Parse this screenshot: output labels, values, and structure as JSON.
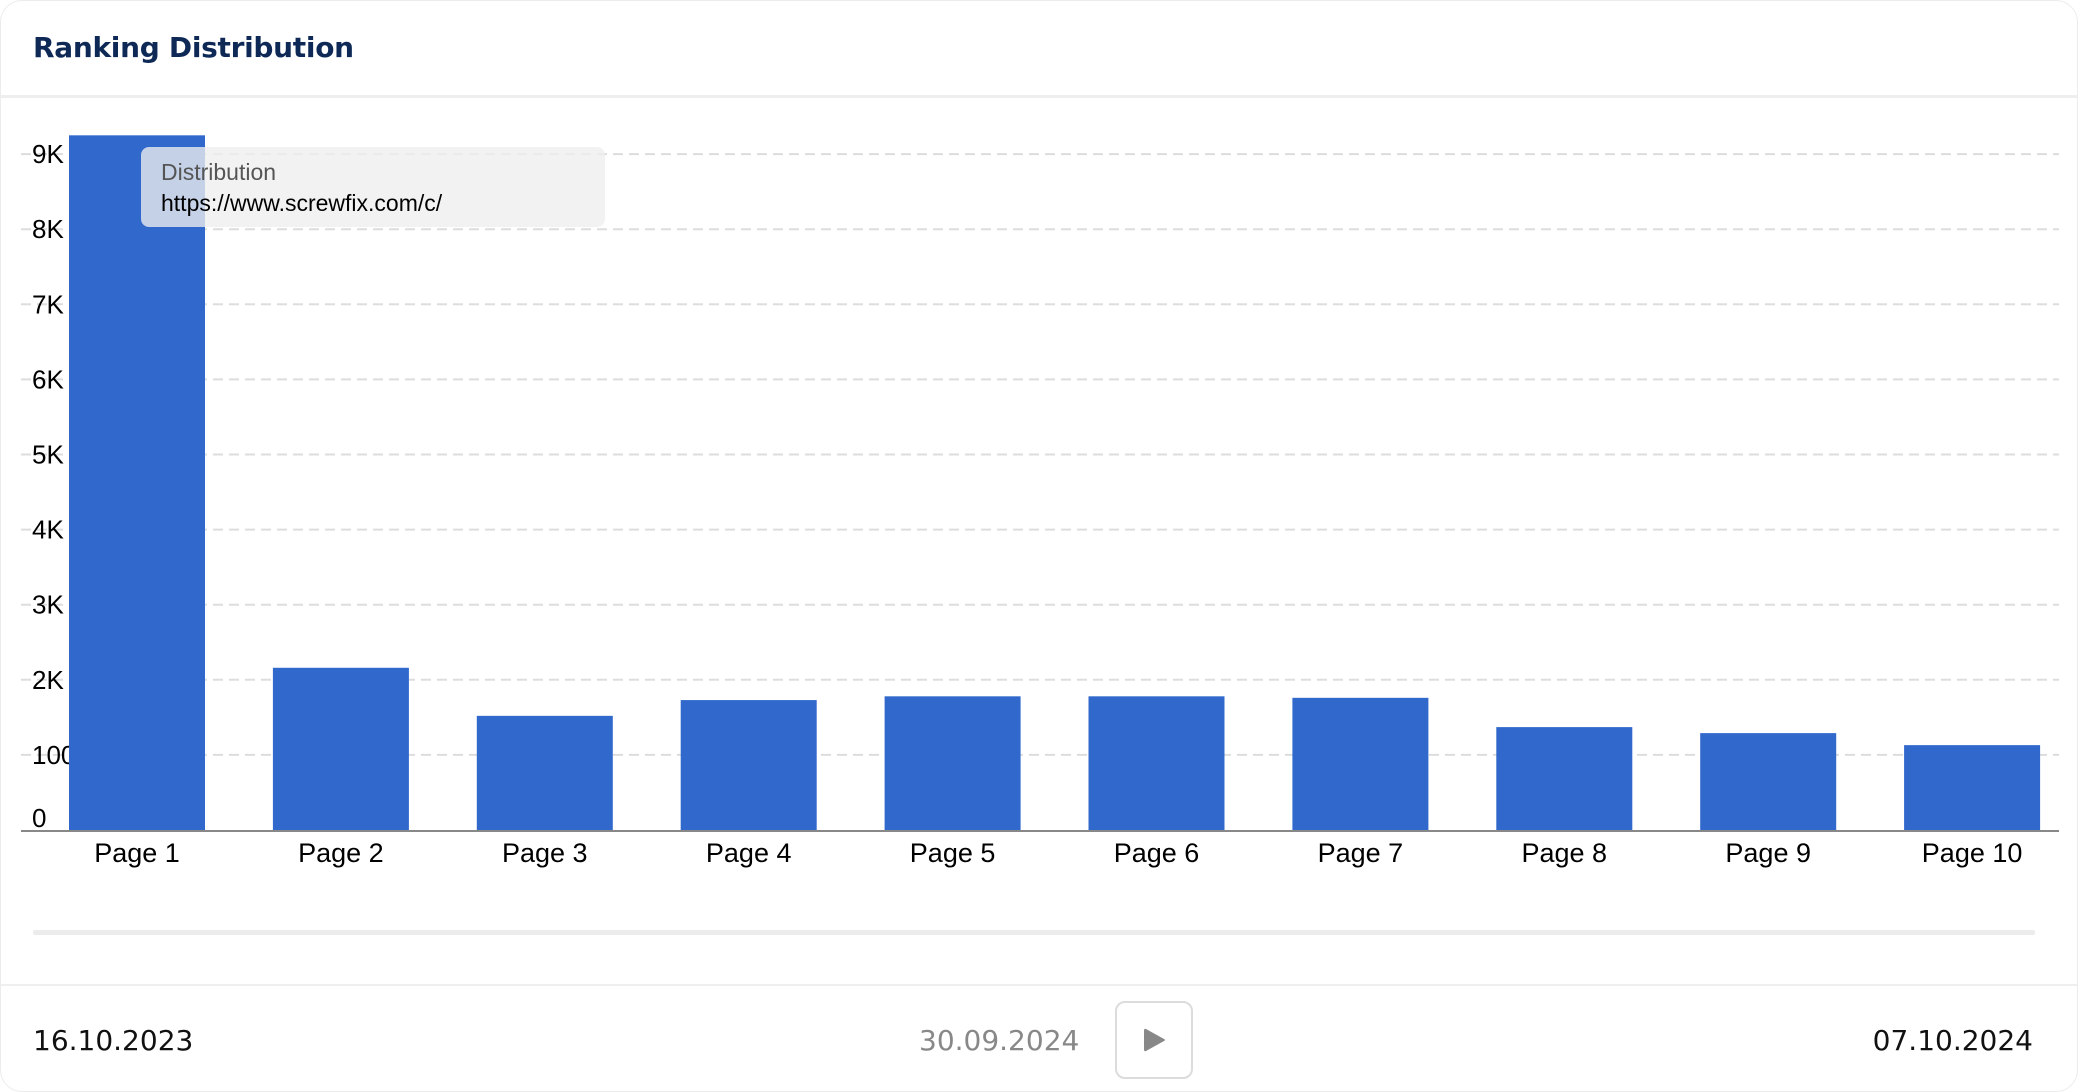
{
  "header": {
    "title": "Ranking Distribution"
  },
  "tooltip": {
    "label": "Distribution",
    "value": "https://www.screwfix.com/c/"
  },
  "timeline": {
    "start_date": "16.10.2023",
    "current_date": "30.09.2024",
    "end_date": "07.10.2024",
    "play_icon": "play-icon"
  },
  "colors": {
    "bar": "#3068cc",
    "title": "#0f2957",
    "gridline": "#dddddd",
    "axis": "#888888"
  },
  "chart_data": {
    "type": "bar",
    "title": "Ranking Distribution",
    "categories": [
      "Page 1",
      "Page 2",
      "Page 3",
      "Page 4",
      "Page 5",
      "Page 6",
      "Page 7",
      "Page 8",
      "Page 9",
      "Page 10"
    ],
    "series": [
      {
        "name": "Distribution - https://www.screwfix.com/c/",
        "values": [
          9250,
          2160,
          1520,
          1730,
          1780,
          1780,
          1760,
          1370,
          1290,
          1130
        ]
      }
    ],
    "xlabel": "",
    "ylabel": "",
    "ylim": [
      0,
      9000
    ],
    "yticks": [
      0,
      1000,
      2000,
      3000,
      4000,
      5000,
      6000,
      7000,
      8000,
      9000
    ],
    "ytick_labels": [
      "0",
      "1000",
      "2K",
      "3K",
      "4K",
      "5K",
      "6K",
      "7K",
      "8K",
      "9K"
    ],
    "grid": true,
    "legend": "none"
  }
}
